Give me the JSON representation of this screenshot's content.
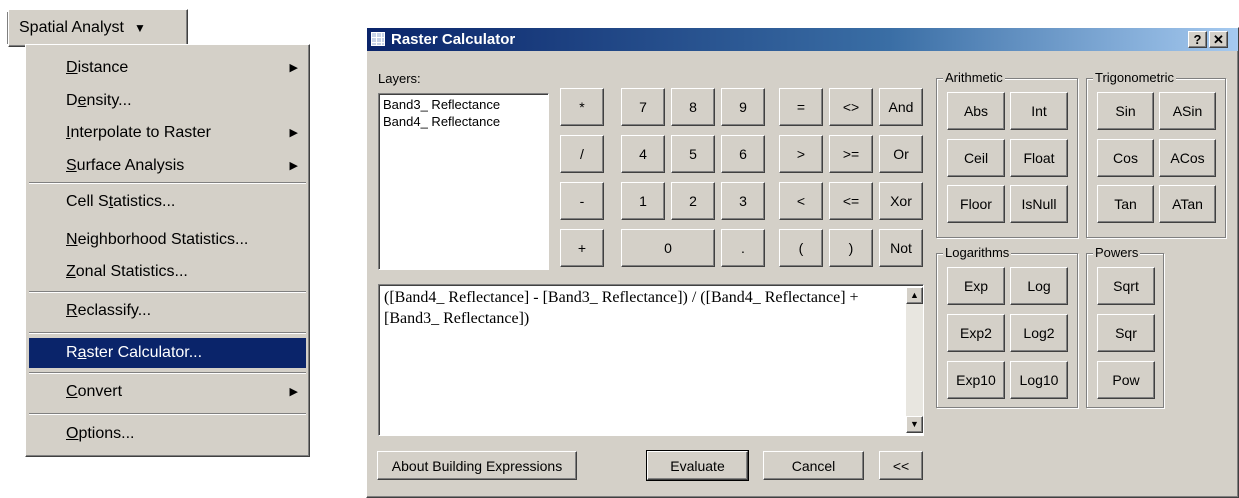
{
  "toolbar": {
    "label": "Spatial Analyst",
    "dropdown_icon": "▼"
  },
  "menu": {
    "items": [
      {
        "before": "",
        "key": "D",
        "after": "istance",
        "submenu": true
      },
      {
        "before": "D",
        "key": "e",
        "after": "nsity...",
        "submenu": false
      },
      {
        "before": "",
        "key": "I",
        "after": "nterpolate to Raster",
        "submenu": true
      },
      {
        "before": "",
        "key": "S",
        "after": "urface Analysis",
        "submenu": true
      },
      {
        "before": "Cell S",
        "key": "t",
        "after": "atistics...",
        "submenu": false
      },
      {
        "before": "",
        "key": "N",
        "after": "eighborhood Statistics...",
        "submenu": false
      },
      {
        "before": "",
        "key": "Z",
        "after": "onal Statistics...",
        "submenu": false
      },
      {
        "before": "",
        "key": "R",
        "after": "eclassify...",
        "submenu": false
      },
      {
        "before": "R",
        "key": "a",
        "after": "ster Calculator...",
        "submenu": false,
        "selected": true
      },
      {
        "before": "",
        "key": "C",
        "after": "onvert",
        "submenu": true
      },
      {
        "before": "",
        "key": "O",
        "after": "ptions...",
        "submenu": false
      }
    ],
    "submenu_icon": "▶"
  },
  "dialog": {
    "title": "Raster Calculator",
    "help_label": "?",
    "close_label": "✕",
    "layers_label": "Layers:",
    "layers": [
      "Band3_ Reflectance",
      "Band4_ Reflectance"
    ],
    "expression": "([Band4_ Reflectance] - [Band3_ Reflectance]) / ([Band4_ Reflectance] + [Band3_ Reflectance])",
    "operators": [
      "*",
      "/",
      "-",
      "+"
    ],
    "digits": [
      "7",
      "8",
      "9",
      "4",
      "5",
      "6",
      "1",
      "2",
      "3",
      "0",
      "."
    ],
    "relational": [
      "=",
      "<>",
      "And",
      ">",
      ">=",
      "Or",
      "<",
      "<=",
      "Xor",
      "(",
      ")",
      "Not"
    ],
    "groups": {
      "arithmetic": {
        "title": "Arithmetic",
        "buttons": [
          "Abs",
          "Int",
          "Ceil",
          "Float",
          "Floor",
          "IsNull"
        ]
      },
      "trigonometric": {
        "title": "Trigonometric",
        "buttons": [
          "Sin",
          "ASin",
          "Cos",
          "ACos",
          "Tan",
          "ATan"
        ]
      },
      "logarithms": {
        "title": "Logarithms",
        "buttons": [
          "Exp",
          "Log",
          "Exp2",
          "Log2",
          "Exp10",
          "Log10"
        ]
      },
      "powers": {
        "title": "Powers",
        "buttons": [
          "Sqrt",
          "Sqr",
          "Pow"
        ]
      }
    },
    "bottom": {
      "about_label": "About Building Expressions",
      "evaluate_label": "Evaluate",
      "cancel_label": "Cancel",
      "collapse_label": "<<"
    },
    "scroll_icons": {
      "left": "◀",
      "right": "▶",
      "up": "▲",
      "down": "▼"
    }
  }
}
